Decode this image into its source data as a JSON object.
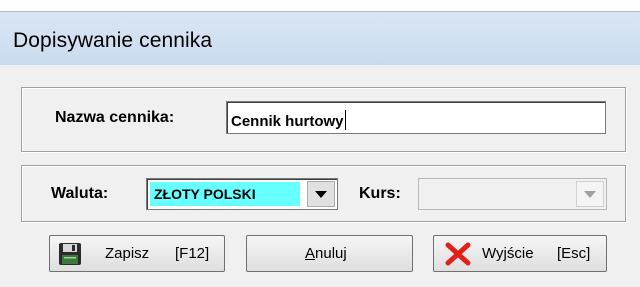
{
  "dialog": {
    "title": "Dopisywanie cennika"
  },
  "name_section": {
    "label": "Nazwa cennika:",
    "value": "Cennik hurtowy"
  },
  "currency_section": {
    "waluta_label": "Waluta:",
    "waluta_value": "ZŁOTY POLSKI",
    "kurs_label": "Kurs:",
    "kurs_value": ""
  },
  "buttons": {
    "save": {
      "label": "Zapisz",
      "shortcut": "[F12]"
    },
    "cancel": {
      "label_first": "A",
      "label_rest": "nuluj"
    },
    "exit": {
      "label": "Wyjście",
      "shortcut": "[Esc]"
    }
  },
  "icons": {
    "save": "floppy-disk-icon",
    "exit": "red-x-icon",
    "dropdown": "chevron-down-icon"
  },
  "colors": {
    "waluta_highlight": "#67ffff",
    "exit_icon": "#e0201b",
    "titlebar": "#c9dbee"
  }
}
